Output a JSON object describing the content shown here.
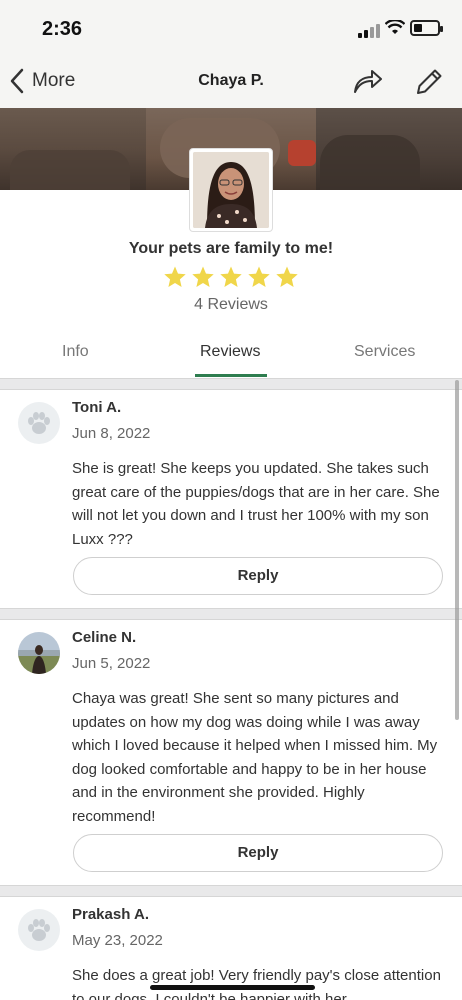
{
  "status_bar": {
    "time": "2:36"
  },
  "nav": {
    "back_label": "More",
    "title": "Chaya P."
  },
  "profile": {
    "tagline": "Your pets are family to me!",
    "rating_stars": 5,
    "reviews_count": "4 Reviews"
  },
  "tabs": [
    {
      "label": "Info"
    },
    {
      "label": "Reviews",
      "active": true
    },
    {
      "label": "Services"
    }
  ],
  "reviews": [
    {
      "name": "Toni A.",
      "date": "Jun 8, 2022",
      "text": "She is great! She keeps you updated. She takes such great care of the puppies/dogs that are in her care. She will not let you down and I trust her 100% with my son Luxx ???",
      "reply_label": "Reply"
    },
    {
      "name": "Celine N.",
      "date": "Jun 5, 2022",
      "text": "Chaya was great! She sent so many pictures and updates on how my dog was doing while I was away which I loved because it helped when I missed him. My dog looked comfortable and happy to be in her house and in the environment she provided. Highly recommend!",
      "reply_label": "Reply"
    },
    {
      "name": "Prakash A.",
      "date": "May 23, 2022",
      "text": "She does a great job! Very friendly pay's close attention to our dogs. I couldn't be happier with her"
    }
  ],
  "colors": {
    "accent_green": "#2e7d4f",
    "star_yellow": "#f0d64a",
    "divider_gray": "#e9e9ea"
  }
}
